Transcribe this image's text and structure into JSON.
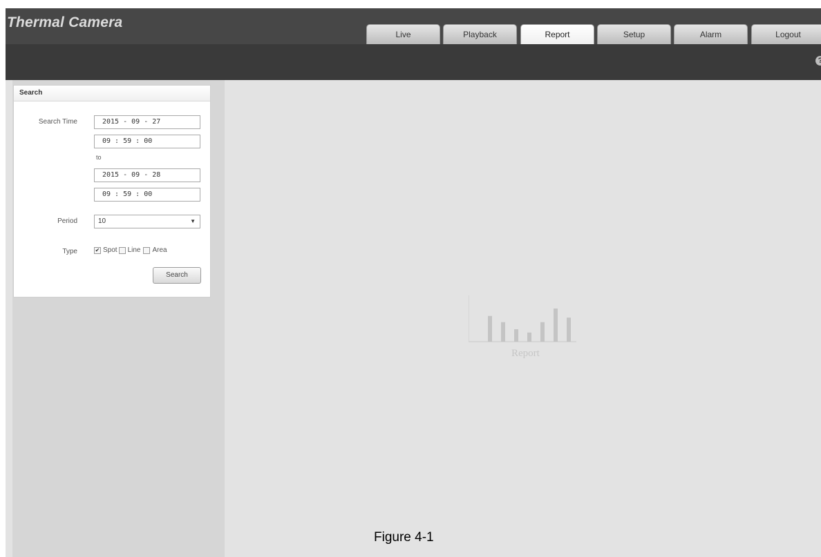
{
  "app": {
    "title": "Thermal Camera"
  },
  "tabs": [
    {
      "label": "Live"
    },
    {
      "label": "Playback"
    },
    {
      "label": "Report",
      "active": true
    },
    {
      "label": "Setup"
    },
    {
      "label": "Alarm"
    },
    {
      "label": "Logout"
    }
  ],
  "header": {
    "help_icon": "?"
  },
  "search_panel": {
    "title": "Search",
    "search_time_label": "Search Time",
    "start_date": "2015 - 09 - 27",
    "start_time": "09 : 59 : 00",
    "to_label": "to",
    "end_date": "2015 - 09 - 28",
    "end_time": "09 : 59 : 00",
    "period_label": "Period",
    "period_value": "10",
    "type_label": "Type",
    "types": [
      {
        "label": "Spot",
        "checked": true
      },
      {
        "label": "Line",
        "checked": false
      },
      {
        "label": "Area",
        "checked": false
      }
    ],
    "search_button": "Search"
  },
  "placeholder": {
    "label": "Report",
    "bar_levels": [
      0.62,
      0.47,
      0.3,
      0.22,
      0.47,
      0.8,
      0.58
    ]
  },
  "caption": "Figure 4-1",
  "colors": {
    "topbar": "#474747",
    "subbar": "#3a3a3a",
    "workspace": "#e3e3e3",
    "sidebar": "#d6d6d6"
  }
}
